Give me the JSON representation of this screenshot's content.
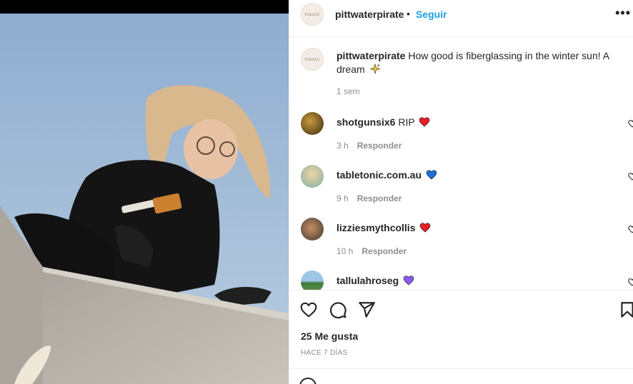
{
  "post": {
    "username": "pittwaterpirate",
    "follow_label": "Seguir",
    "avatar_text": "PIRATE",
    "more_label": "•••"
  },
  "caption": {
    "username": "pittwaterpirate",
    "text": "How good is fiberglassing in the winter sun! A dream",
    "emoji": "sparkles-icon",
    "time": "1 sem"
  },
  "comments": [
    {
      "username": "shotgunsix6",
      "text": "RIP",
      "emoji": "red-heart-icon",
      "time": "3 h",
      "reply": "Responder"
    },
    {
      "username": "tabletonic.com.au",
      "text": "",
      "emoji": "blue-heart-icon",
      "time": "9 h",
      "reply": "Responder"
    },
    {
      "username": "lizziesmythcollis",
      "text": "",
      "emoji": "red-heart-icon",
      "time": "10 h",
      "reply": "Responder"
    },
    {
      "username": "tallulahroseg",
      "text": "",
      "emoji": "purple-heart-icon",
      "time": "",
      "reply": ""
    }
  ],
  "actions": {
    "likes": "25 Me gusta",
    "date": "HACE 7 DÍAS"
  },
  "colors": {
    "link": "#1a9ee6",
    "red_heart": "#ed1c24",
    "blue_heart": "#1e6fd9",
    "purple_heart": "#8a5cf6",
    "sparkle": "#f7c81f"
  }
}
